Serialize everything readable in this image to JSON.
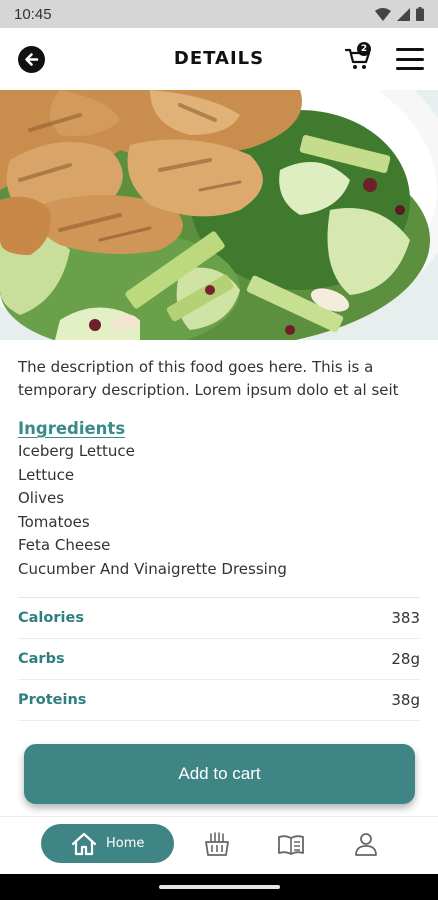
{
  "status_bar": {
    "time": "10:45"
  },
  "header": {
    "title": "DETAILS",
    "cart_count": "2"
  },
  "food": {
    "description": "The description of this food goes here. This is a temporary description. Lorem ipsum dolo et al seit",
    "ingredients_title": "Ingredients",
    "ingredients": [
      "Iceberg Lettuce",
      "Lettuce",
      "Olives",
      "Tomatoes",
      "Feta Cheese",
      "Cucumber And Vinaigrette Dressing"
    ],
    "nutrition": [
      {
        "label": "Calories",
        "value": "383"
      },
      {
        "label": "Carbs",
        "value": "28g"
      },
      {
        "label": "Proteins",
        "value": "38g"
      }
    ]
  },
  "actions": {
    "add_to_cart": "Add to cart"
  },
  "bottom_nav": {
    "items": [
      {
        "label": "Home",
        "icon": "home-icon",
        "active": true
      },
      {
        "label": "",
        "icon": "food-basket-icon"
      },
      {
        "label": "",
        "icon": "menu-book-icon"
      },
      {
        "label": "",
        "icon": "profile-icon"
      }
    ]
  },
  "colors": {
    "accent": "#3f8586",
    "text": "#333333",
    "label": "#2f7f80"
  }
}
